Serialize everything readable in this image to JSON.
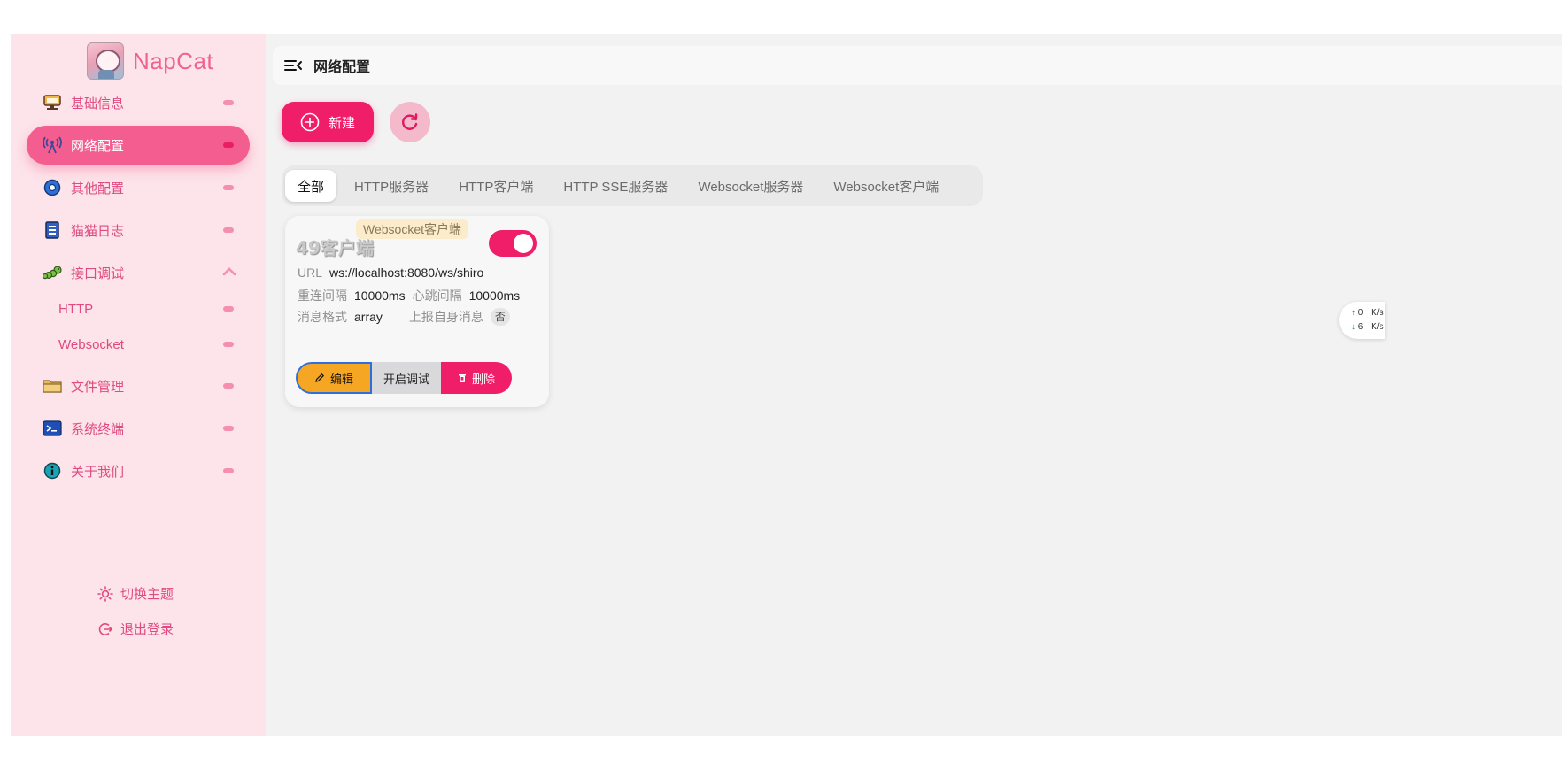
{
  "app": {
    "name": "NapCat"
  },
  "sidebar": {
    "items": [
      {
        "label": "基础信息",
        "icon": "dashboard-icon"
      },
      {
        "label": "网络配置",
        "icon": "antenna-icon",
        "active": true
      },
      {
        "label": "其他配置",
        "icon": "gear-icon"
      },
      {
        "label": "猫猫日志",
        "icon": "notebook-icon"
      },
      {
        "label": "接口调试",
        "icon": "caterpillar-icon",
        "expanded": true
      }
    ],
    "sub_items": [
      {
        "label": "HTTP"
      },
      {
        "label": "Websocket"
      }
    ],
    "items_after": [
      {
        "label": "文件管理",
        "icon": "folder-icon"
      },
      {
        "label": "系统终端",
        "icon": "terminal-icon"
      },
      {
        "label": "关于我们",
        "icon": "info-icon"
      }
    ],
    "bottom": {
      "theme_label": "切换主题",
      "logout_label": "退出登录"
    }
  },
  "header": {
    "title": "网络配置"
  },
  "toolbar": {
    "new_label": "新建"
  },
  "tabs": [
    {
      "label": "全部",
      "active": true
    },
    {
      "label": "HTTP服务器"
    },
    {
      "label": "HTTP客户端"
    },
    {
      "label": "HTTP SSE服务器"
    },
    {
      "label": "Websocket服务器"
    },
    {
      "label": "Websocket客户端"
    }
  ],
  "card": {
    "title": "49客户端",
    "type_badge": "Websocket客户端",
    "enabled": true,
    "url_label": "URL",
    "url_value": "ws://localhost:8080/ws/shiro",
    "reconnect_label": "重连间隔",
    "reconnect_value": "10000ms",
    "heartbeat_label": "心跳间隔",
    "heartbeat_value": "10000ms",
    "format_label": "消息格式",
    "format_value": "array",
    "report_self_label": "上报自身消息",
    "report_self_value": "否",
    "edit_label": "编辑",
    "debug_label": "开启调试",
    "delete_label": "删除"
  },
  "netspeed": {
    "up_value": "0",
    "down_value": "6",
    "unit": "K/s"
  },
  "colors": {
    "accent": "#f01d68",
    "sidebar_bg": "#fde3ea",
    "sidebar_text": "#e04a80",
    "main_bg": "#f2f2f2",
    "edit_button": "#f5a623"
  }
}
